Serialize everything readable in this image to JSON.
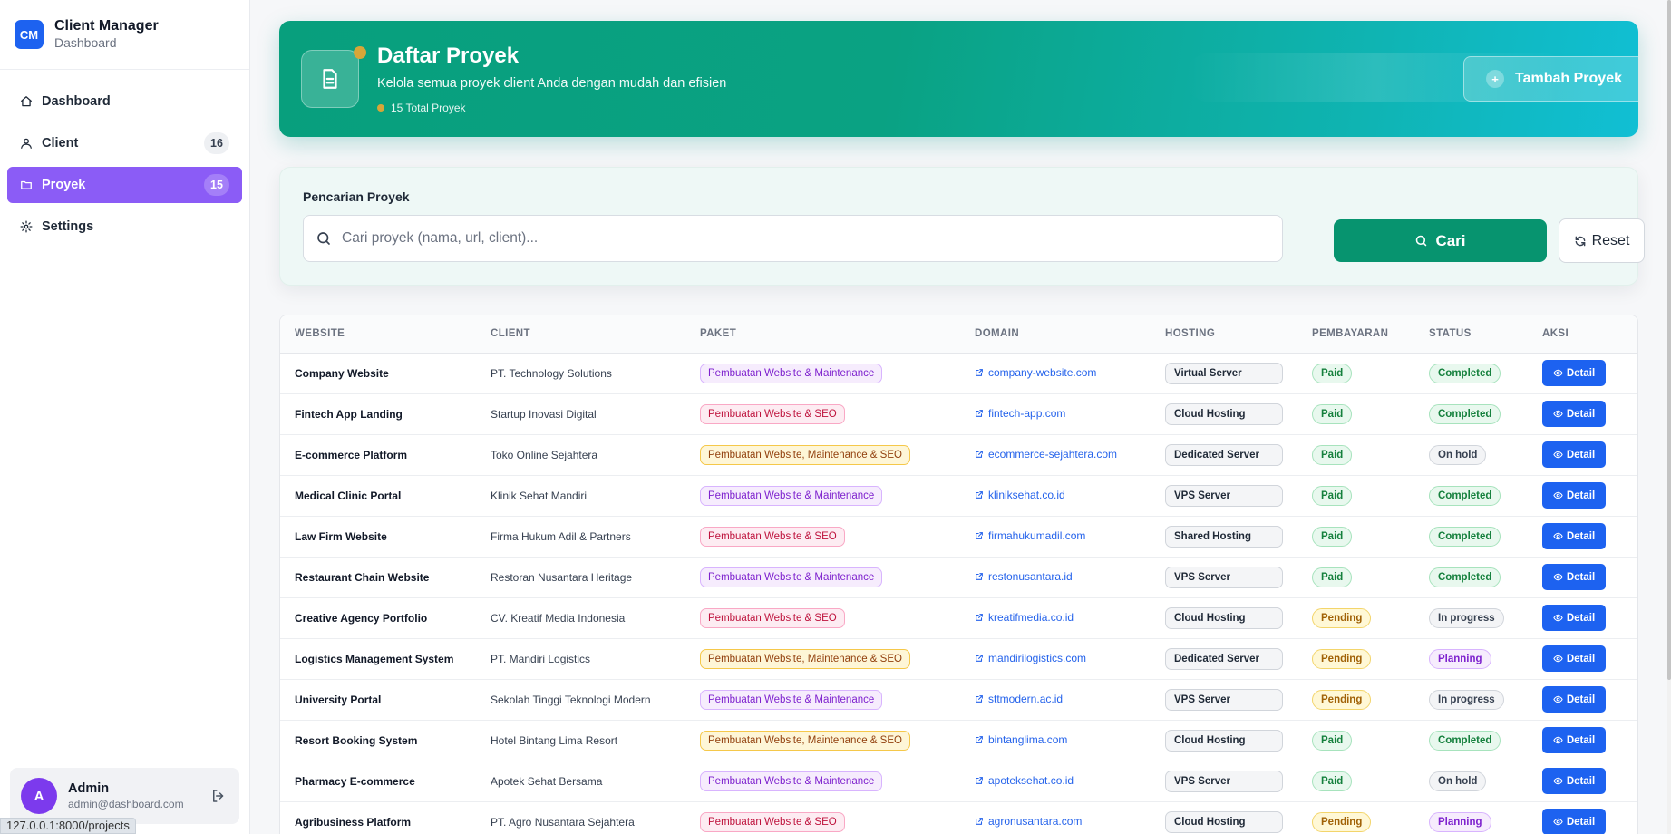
{
  "app": {
    "logo": "CM",
    "title": "Client Manager",
    "subtitle": "Dashboard"
  },
  "nav": [
    {
      "label": "Dashboard",
      "icon": "home-icon"
    },
    {
      "label": "Client",
      "icon": "users-icon",
      "count": "16"
    },
    {
      "label": "Proyek",
      "icon": "folder-icon",
      "count": "15",
      "active": true
    },
    {
      "label": "Settings",
      "icon": "gear-icon"
    }
  ],
  "user": {
    "initial": "A",
    "name": "Admin",
    "email": "admin@dashboard.com"
  },
  "status_url": "127.0.0.1:8000/projects",
  "hero": {
    "title": "Daftar Proyek",
    "subtitle": "Kelola semua proyek client Anda dengan mudah dan efisien",
    "count_text": "15 Total Proyek",
    "add_button": "Tambah Proyek"
  },
  "search": {
    "label": "Pencarian Proyek",
    "placeholder": "Cari proyek (nama, url, client)...",
    "value": "",
    "search_button": "Cari",
    "reset_button": "Reset"
  },
  "table": {
    "headers": [
      "WEBSITE",
      "CLIENT",
      "PAKET",
      "DOMAIN",
      "HOSTING",
      "PEMBAYARAN",
      "STATUS",
      "AKSI"
    ],
    "detail_label": "Detail",
    "rows": [
      {
        "website": "Company Website",
        "client": "PT. Technology Solutions",
        "paket": "Pembuatan Website & Maintenance",
        "paket_style": "purple",
        "domain": "company-website.com",
        "hosting": "Virtual Server",
        "payment": "Paid",
        "status": "Completed",
        "status_style": "completed"
      },
      {
        "website": "Fintech App Landing",
        "client": "Startup Inovasi Digital",
        "paket": "Pembuatan Website & SEO",
        "paket_style": "pink",
        "domain": "fintech-app.com",
        "hosting": "Cloud Hosting",
        "payment": "Paid",
        "status": "Completed",
        "status_style": "completed"
      },
      {
        "website": "E-commerce Platform",
        "client": "Toko Online Sejahtera",
        "paket": "Pembuatan Website, Maintenance & SEO",
        "paket_style": "yellow",
        "domain": "ecommerce-sejahtera.com",
        "hosting": "Dedicated Server",
        "payment": "Paid",
        "status": "On hold",
        "status_style": "onhold"
      },
      {
        "website": "Medical Clinic Portal",
        "client": "Klinik Sehat Mandiri",
        "paket": "Pembuatan Website & Maintenance",
        "paket_style": "purple",
        "domain": "kliniksehat.co.id",
        "hosting": "VPS Server",
        "payment": "Paid",
        "status": "Completed",
        "status_style": "completed"
      },
      {
        "website": "Law Firm Website",
        "client": "Firma Hukum Adil & Partners",
        "paket": "Pembuatan Website & SEO",
        "paket_style": "pink",
        "domain": "firmahukumadil.com",
        "hosting": "Shared Hosting",
        "payment": "Paid",
        "status": "Completed",
        "status_style": "completed"
      },
      {
        "website": "Restaurant Chain Website",
        "client": "Restoran Nusantara Heritage",
        "paket": "Pembuatan Website & Maintenance",
        "paket_style": "purple",
        "domain": "restonusantara.id",
        "hosting": "VPS Server",
        "payment": "Paid",
        "status": "Completed",
        "status_style": "completed"
      },
      {
        "website": "Creative Agency Portfolio",
        "client": "CV. Kreatif Media Indonesia",
        "paket": "Pembuatan Website & SEO",
        "paket_style": "pink",
        "domain": "kreatifmedia.co.id",
        "hosting": "Cloud Hosting",
        "payment": "Pending",
        "status": "In progress",
        "status_style": "inprogress"
      },
      {
        "website": "Logistics Management System",
        "client": "PT. Mandiri Logistics",
        "paket": "Pembuatan Website, Maintenance & SEO",
        "paket_style": "yellow",
        "domain": "mandirilogistics.com",
        "hosting": "Dedicated Server",
        "payment": "Pending",
        "status": "Planning",
        "status_style": "planning"
      },
      {
        "website": "University Portal",
        "client": "Sekolah Tinggi Teknologi Modern",
        "paket": "Pembuatan Website & Maintenance",
        "paket_style": "purple",
        "domain": "sttmodern.ac.id",
        "hosting": "VPS Server",
        "payment": "Pending",
        "status": "In progress",
        "status_style": "inprogress"
      },
      {
        "website": "Resort Booking System",
        "client": "Hotel Bintang Lima Resort",
        "paket": "Pembuatan Website, Maintenance & SEO",
        "paket_style": "yellow",
        "domain": "bintanglima.com",
        "hosting": "Cloud Hosting",
        "payment": "Paid",
        "status": "Completed",
        "status_style": "completed"
      },
      {
        "website": "Pharmacy E-commerce",
        "client": "Apotek Sehat Bersama",
        "paket": "Pembuatan Website & Maintenance",
        "paket_style": "purple",
        "domain": "apoteksehat.co.id",
        "hosting": "VPS Server",
        "payment": "Paid",
        "status": "On hold",
        "status_style": "onhold"
      },
      {
        "website": "Agribusiness Platform",
        "client": "PT. Agro Nusantara Sejahtera",
        "paket": "Pembuatan Website & SEO",
        "paket_style": "pink",
        "domain": "agronusantara.com",
        "hosting": "Cloud Hosting",
        "payment": "Pending",
        "status": "Planning",
        "status_style": "planning"
      }
    ]
  }
}
